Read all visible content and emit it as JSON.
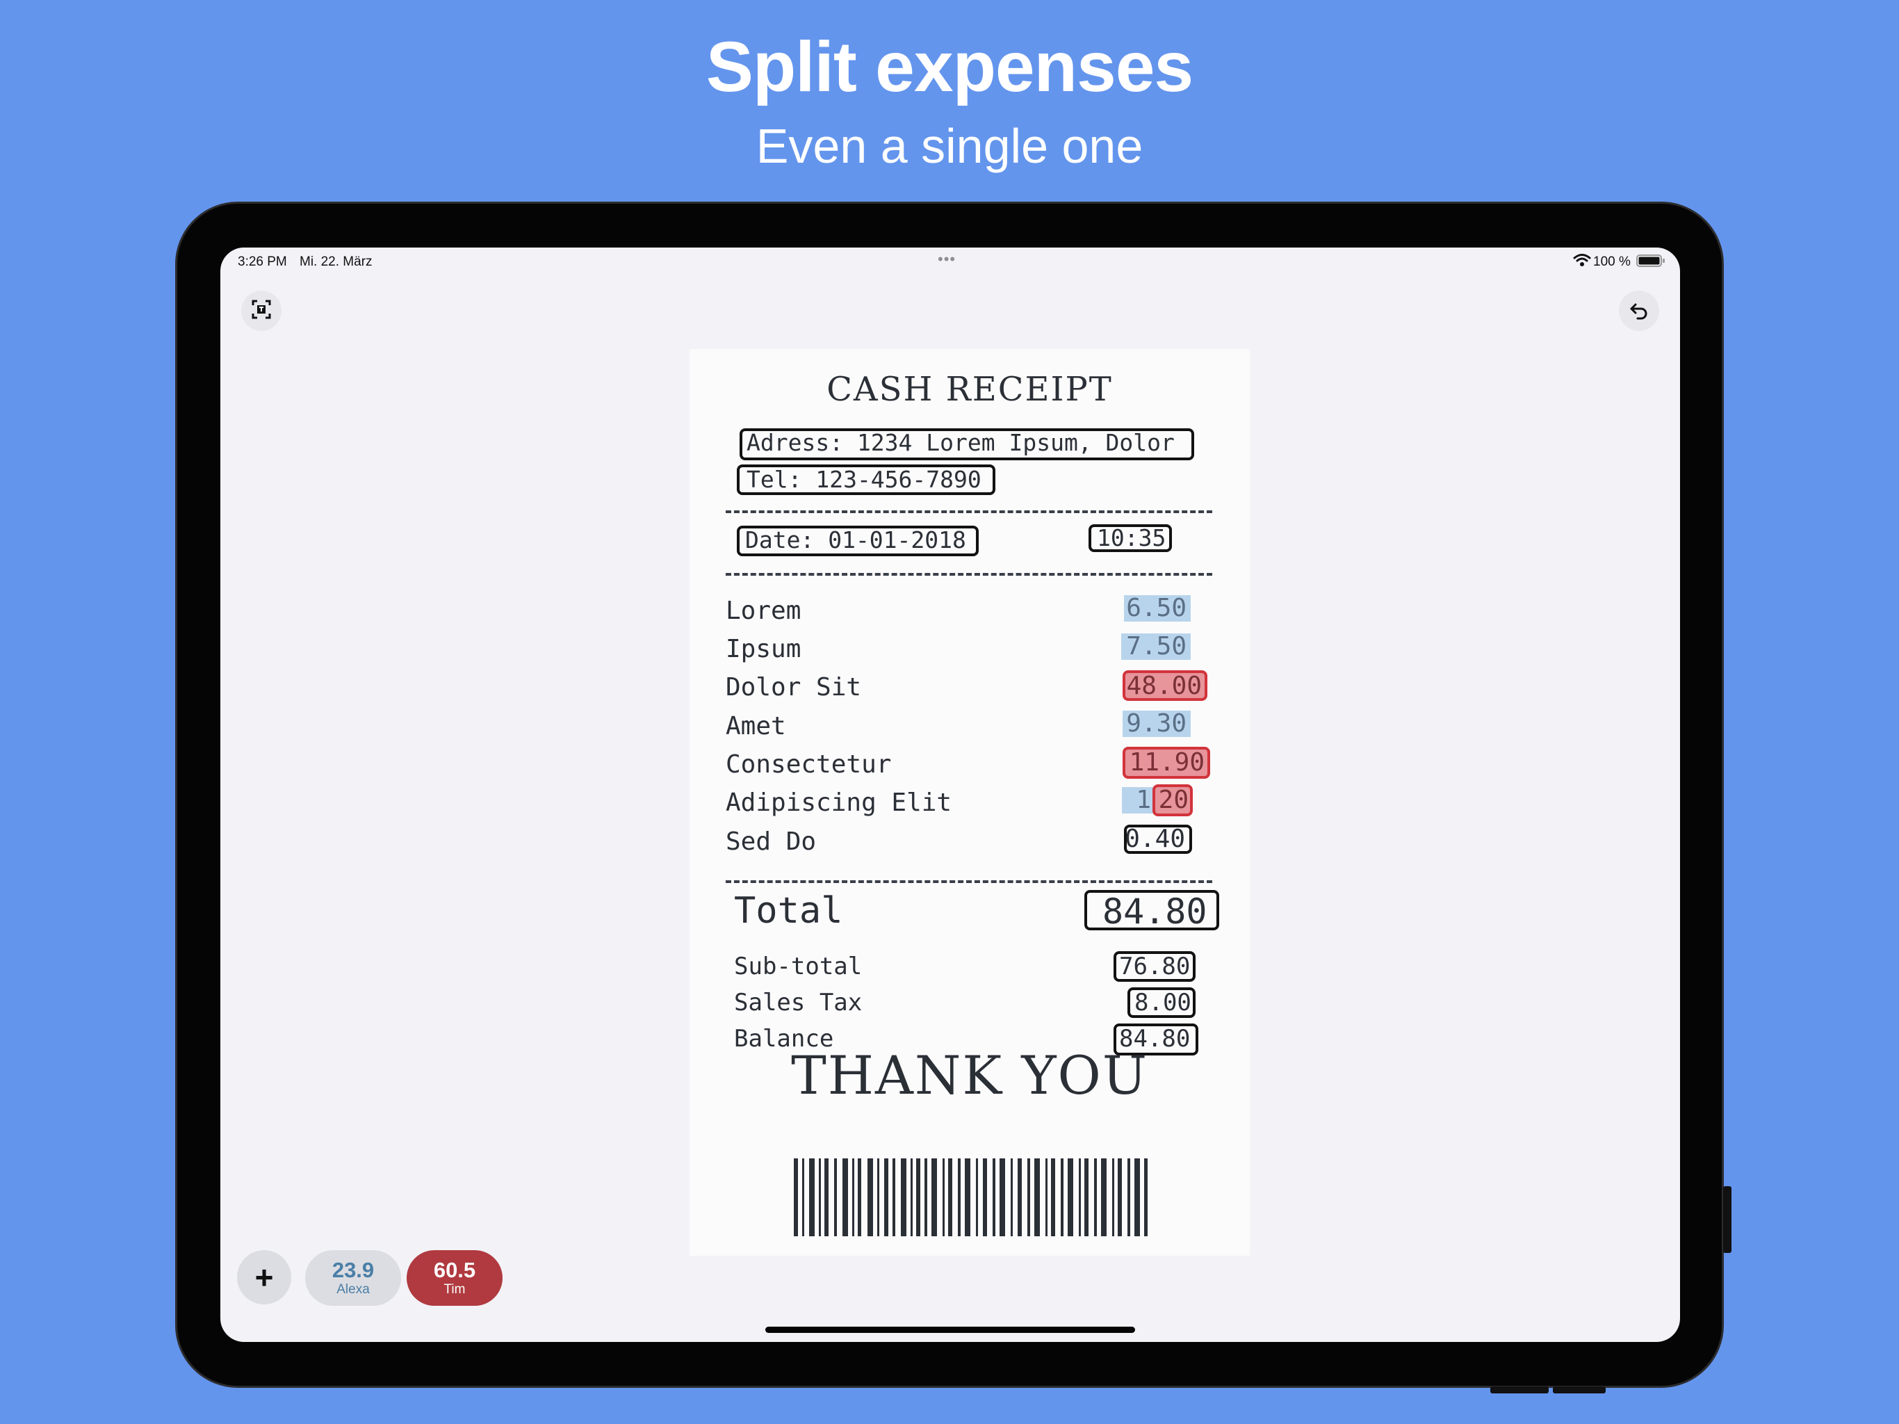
{
  "promo": {
    "title": "Split expenses",
    "subtitle": "Even a single one"
  },
  "statusbar": {
    "time": "3:26 PM",
    "date": "Mi. 22. März",
    "center_dots": "•••",
    "battery": "100 %"
  },
  "toolbar": {
    "left_icon": "scan-text-icon",
    "right_icon": "undo-icon"
  },
  "receipt": {
    "title": "CASH RECEIPT",
    "address": "Adress: 1234 Lorem Ipsum, Dolor",
    "tel": "Tel: 123-456-7890",
    "date": "Date: 01-01-2018",
    "time": "10:35",
    "items": [
      {
        "name": "Lorem",
        "amount": "6.50",
        "assigned": "Alexa"
      },
      {
        "name": "Ipsum",
        "amount": "7.50",
        "assigned": "Alexa"
      },
      {
        "name": "Dolor Sit",
        "amount": "48.00",
        "assigned": "Tim"
      },
      {
        "name": "Amet",
        "amount": "9.30",
        "assigned": "Alexa"
      },
      {
        "name": "Consectetur",
        "amount": "11.90",
        "assigned": "Tim"
      },
      {
        "name": "Adipiscing Elit",
        "amount_part_a": "1",
        "amount_part_b": "20",
        "assigned": "split"
      },
      {
        "name": "Sed Do",
        "amount": "0.40",
        "assigned": "none"
      }
    ],
    "total_label": "Total",
    "total_value": "84.80",
    "subtotal_label": "Sub-total",
    "subtotal_value": "76.80",
    "tax_label": "Sales Tax",
    "tax_value": "8.00",
    "balance_label": "Balance",
    "balance_value": "84.80",
    "thanks": "THANK YOU"
  },
  "people": {
    "add_label": "+",
    "list": [
      {
        "name": "Alexa",
        "amount": "23.9",
        "color": "#4a7ea6",
        "bg": "#dcdde2"
      },
      {
        "name": "Tim",
        "amount": "60.5",
        "color": "#ffffff",
        "bg": "#b03a3f"
      }
    ]
  },
  "colors": {
    "background": "#6495ED",
    "alexa_highlight": "#b8d4ec",
    "tim_highlight": "#e7949b",
    "tim_border": "#d2343c"
  }
}
